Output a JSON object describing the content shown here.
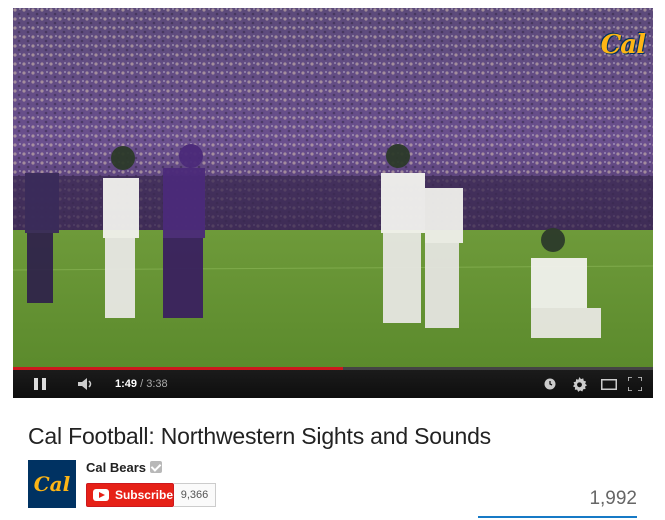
{
  "player": {
    "watermark": "Cal",
    "progress_fraction": 0.516,
    "current_time": "1:49",
    "duration": "/ 3:38",
    "controls": {
      "play_state_icon": "pause-icon",
      "volume_icon": "volume-icon",
      "right_icons": [
        "watch-later-icon",
        "gear-icon",
        "player-size-icon",
        "fullscreen-icon"
      ]
    }
  },
  "video": {
    "title": "Cal Football: Northwestern Sights and Sounds",
    "views": "1,992"
  },
  "channel": {
    "avatar_text": "Cal",
    "name": "Cal Bears",
    "subscribe_label": "Subscribe",
    "subscriber_count": "9,366"
  },
  "colors": {
    "subscribe_red": "#e62117",
    "progress_red": "#cc181e",
    "cal_blue": "#003262",
    "cal_gold": "#fdb515",
    "views_bar_blue": "#167ac6"
  }
}
